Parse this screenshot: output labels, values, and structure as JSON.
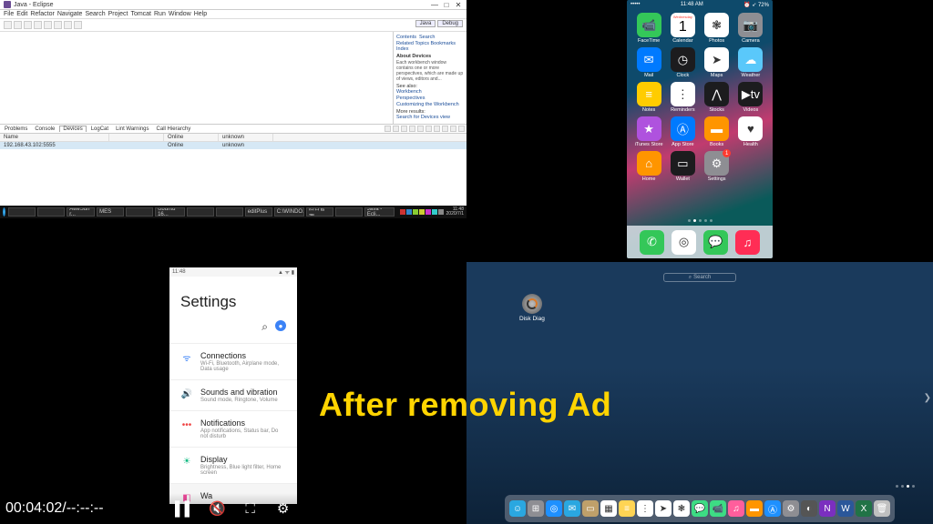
{
  "overlay": "After removing Ad",
  "video": {
    "time": "00:04:02/--:--:--"
  },
  "eclipse": {
    "title": "Java - Eclipse",
    "menu": [
      "File",
      "Edit",
      "Refactor",
      "Navigate",
      "Search",
      "Project",
      "Tomcat",
      "Run",
      "Window",
      "Help"
    ],
    "perspectives": [
      "Java",
      "Debug"
    ],
    "help": {
      "links_top": [
        "Contents",
        "Search"
      ],
      "links2": [
        "Related Topics",
        "Bookmarks",
        "Index"
      ],
      "section": "About Devices",
      "body": "Each workbench window contains one or more perspectives, which are made up of views, editors and...",
      "seealso": "See also:",
      "items": [
        "Workbench",
        "Perspectives",
        "Customizing the Workbench"
      ],
      "more": "More results:",
      "search": "Search for Devices view"
    },
    "bottom_tabs": [
      "Problems",
      "Console",
      "Devices",
      "LogCat",
      "Lint Warnings",
      "Call Hierarchy"
    ],
    "active_tab": 2,
    "table_head": [
      "Name",
      "",
      "Online",
      "unknown"
    ],
    "row": "192.168.43.102:5555"
  },
  "taskbar": {
    "items": [
      "",
      "",
      "AweSun r...",
      "MES",
      "",
      "Ubuntu 16...",
      "",
      "",
      "editPlus",
      "C:\\WINDO...",
      "后台管理...",
      "",
      "Java - Ecli..."
    ],
    "clock_top": "11:48",
    "clock_bot": "2020/7/1"
  },
  "ios": {
    "status": {
      "left": "•••••",
      "center": "11:48 AM",
      "right_icons": "⏰ ➶ 72%"
    },
    "apps": [
      {
        "label": "FaceTime",
        "glyph": "📹",
        "cls": "bg-green"
      },
      {
        "label": "Calendar",
        "glyph": "1",
        "cls": "bg-white",
        "sub": "Wednesday"
      },
      {
        "label": "Photos",
        "glyph": "❃",
        "cls": "bg-white"
      },
      {
        "label": "Camera",
        "glyph": "📷",
        "cls": "bg-gray"
      },
      {
        "label": "Mail",
        "glyph": "✉",
        "cls": "bg-blue"
      },
      {
        "label": "Clock",
        "glyph": "◷",
        "cls": "bg-black"
      },
      {
        "label": "Maps",
        "glyph": "➤",
        "cls": "bg-white"
      },
      {
        "label": "Weather",
        "glyph": "☁",
        "cls": "bg-cyan"
      },
      {
        "label": "Notes",
        "glyph": "≡",
        "cls": "bg-yellow"
      },
      {
        "label": "Reminders",
        "glyph": "⋮",
        "cls": "bg-white"
      },
      {
        "label": "Stocks",
        "glyph": "⋀",
        "cls": "bg-black"
      },
      {
        "label": "Videos",
        "glyph": "▶tv",
        "cls": "bg-black"
      },
      {
        "label": "iTunes Store",
        "glyph": "★",
        "cls": "bg-purple"
      },
      {
        "label": "App Store",
        "glyph": "Ⓐ",
        "cls": "bg-blue"
      },
      {
        "label": "Books",
        "glyph": "▬",
        "cls": "bg-orange"
      },
      {
        "label": "Health",
        "glyph": "♥",
        "cls": "bg-white"
      },
      {
        "label": "Home",
        "glyph": "⌂",
        "cls": "bg-orange"
      },
      {
        "label": "Wallet",
        "glyph": "▭",
        "cls": "bg-black"
      },
      {
        "label": "Settings",
        "glyph": "⚙",
        "cls": "bg-gray",
        "badge": "1"
      }
    ],
    "dock": [
      {
        "name": "phone",
        "glyph": "✆",
        "cls": "bg-green"
      },
      {
        "name": "safari",
        "glyph": "◎",
        "cls": "bg-white"
      },
      {
        "name": "messages",
        "glyph": "💬",
        "cls": "bg-green"
      },
      {
        "name": "music",
        "glyph": "♫",
        "cls": "bg-pink"
      }
    ]
  },
  "android": {
    "status_time": "11:48",
    "title": "Settings",
    "items": [
      {
        "title": "Connections",
        "sub": "Wi-Fi, Bluetooth, Airplane mode, Data usage",
        "icon": "ᯤ",
        "color": "#3b82f6"
      },
      {
        "title": "Sounds and vibration",
        "sub": "Sound mode, Ringtone, Volume",
        "icon": "🔊",
        "color": "#8b5cf6"
      },
      {
        "title": "Notifications",
        "sub": "App notifications, Status bar, Do not disturb",
        "icon": "•••",
        "color": "#ef4444"
      },
      {
        "title": "Display",
        "sub": "Brightness, Blue light filter, Home screen",
        "icon": "☀",
        "color": "#10b981"
      },
      {
        "title": "Wa",
        "sub": "",
        "icon": "◧",
        "color": "#ec4899"
      }
    ]
  },
  "mac": {
    "search_placeholder": "Search",
    "desktop_icon": "Disk Diag",
    "dock": [
      {
        "n": "finder",
        "g": "☺",
        "c": "#2aa7e0"
      },
      {
        "n": "launchpad",
        "g": "⊞",
        "c": "#8e8e93"
      },
      {
        "n": "safari",
        "g": "◎",
        "c": "#1e90ff"
      },
      {
        "n": "mail",
        "g": "✉",
        "c": "#2aa7e0"
      },
      {
        "n": "contacts",
        "g": "▭",
        "c": "#bfa06a"
      },
      {
        "n": "calendar",
        "g": "▦",
        "c": "#fff"
      },
      {
        "n": "notes",
        "g": "≡",
        "c": "#ffd454"
      },
      {
        "n": "reminders",
        "g": "⋮",
        "c": "#fff"
      },
      {
        "n": "maps",
        "g": "➤",
        "c": "#fff"
      },
      {
        "n": "photos",
        "g": "❃",
        "c": "#fff"
      },
      {
        "n": "messages",
        "g": "💬",
        "c": "#3ddc84"
      },
      {
        "n": "facetime",
        "g": "📹",
        "c": "#3ddc84"
      },
      {
        "n": "itunes",
        "g": "♫",
        "c": "#ff5e9c"
      },
      {
        "n": "ibooks",
        "g": "▬",
        "c": "#ff9500"
      },
      {
        "n": "appstore",
        "g": "Ⓐ",
        "c": "#1e90ff"
      },
      {
        "n": "preferences",
        "g": "⚙",
        "c": "#8e8e93"
      },
      {
        "n": "diskdiag",
        "g": "◐",
        "c": "#555"
      },
      {
        "n": "onenote",
        "g": "N",
        "c": "#7b2fbf"
      },
      {
        "n": "word",
        "g": "W",
        "c": "#2b579a"
      },
      {
        "n": "excel",
        "g": "X",
        "c": "#217346"
      },
      {
        "n": "trash",
        "g": "🗑",
        "c": "#c0c0c0"
      }
    ]
  }
}
